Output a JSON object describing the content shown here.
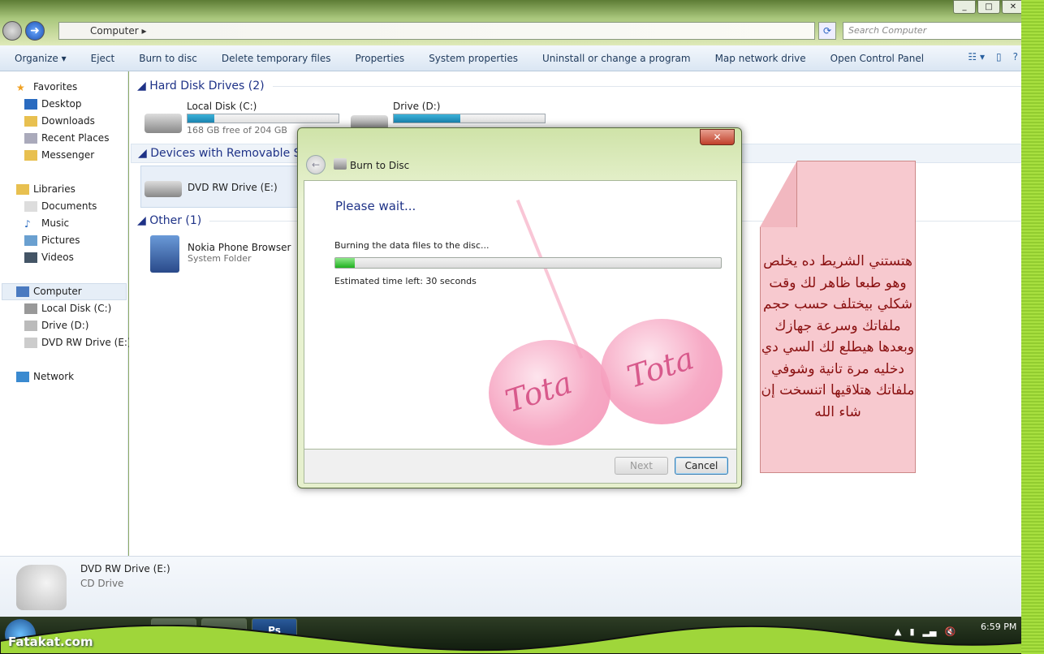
{
  "window": {
    "controls": [
      "_",
      "□",
      "✕"
    ],
    "address": "Computer",
    "search_placeholder": "Search Computer"
  },
  "toolbar": {
    "items": [
      "Organize ▾",
      "Eject",
      "Burn to disc",
      "Delete temporary files",
      "Properties",
      "System properties",
      "Uninstall or change a program",
      "Map network drive",
      "Open Control Panel"
    ]
  },
  "nav": {
    "favorites": "Favorites",
    "fav_items": [
      "Desktop",
      "Downloads",
      "Recent Places",
      "Messenger"
    ],
    "libraries": "Libraries",
    "lib_items": [
      "Documents",
      "Music",
      "Pictures",
      "Videos"
    ],
    "computer": "Computer",
    "comp_items": [
      "Local Disk (C:)",
      "Drive (D:)",
      "DVD RW Drive (E:)"
    ],
    "network": "Network"
  },
  "content": {
    "hdd_group": "Hard Disk Drives (2)",
    "drive_c": {
      "name": "Local Disk (C:)",
      "free": "168 GB free of 204 GB",
      "used_percent": 18
    },
    "drive_d": {
      "name": "Drive (D:)",
      "used_percent": 44
    },
    "removable_group": "Devices with Removable Sto",
    "dvd": {
      "name": "DVD RW Drive (E:)"
    },
    "other_group": "Other (1)",
    "nokia": {
      "name": "Nokia Phone Browser",
      "type": "System Folder"
    }
  },
  "details": {
    "name": "DVD RW Drive (E:)",
    "type": "CD Drive"
  },
  "dialog": {
    "title": "Burn to Disc",
    "heading": "Please wait...",
    "status": "Burning the data files to the disc...",
    "progress_percent": 5,
    "time_left": "Estimated time left: 30 seconds",
    "next": "Next",
    "cancel": "Cancel",
    "watermark": "Tota"
  },
  "note": {
    "text": "هتستني الشريط ده يخلص وهو طبعا ظاهر لك وقت شكلي بيختلف حسب حجم ملفاتك وسرعة جهازك وبعدها هيطلع لك السي دي دخليه مرة تانية وشوفي ملفاتك هتلاقيها اتنسخت إن شاء الله",
    "color": "#f7c9cf"
  },
  "taskbar": {
    "clock": "6:59 PM",
    "app_ps": "Ps",
    "site": "Fatakat.com"
  }
}
